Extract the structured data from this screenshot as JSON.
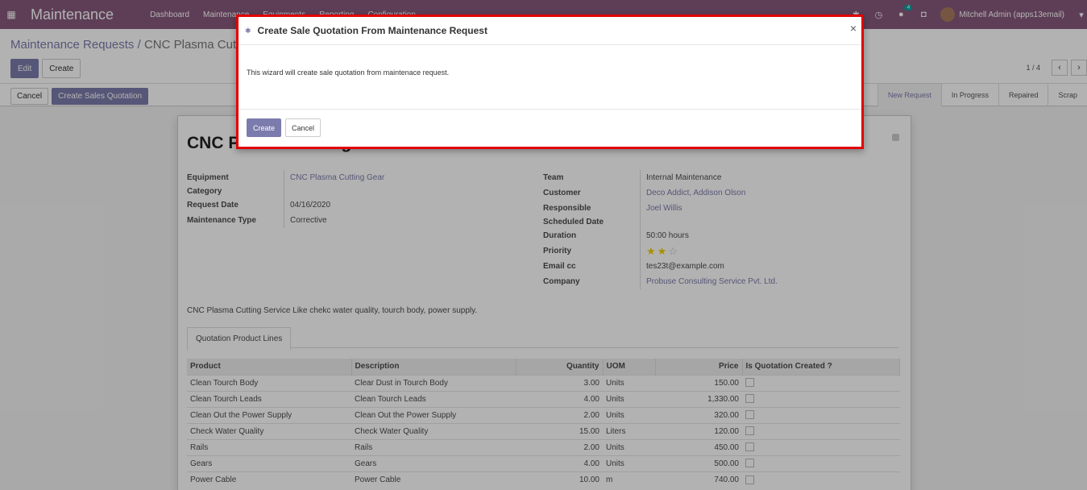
{
  "navbar": {
    "app_name": "Maintenance",
    "menu": [
      "Dashboard",
      "Maintenance",
      "Equipments",
      "Reporting",
      "Configuration"
    ],
    "chat_count": "4",
    "user": "Mitchell Admin (apps13email)"
  },
  "control": {
    "breadcrumb_parent": "Maintenance Requests",
    "breadcrumb_sep": " / ",
    "breadcrumb_current": "CNC Plasma Cutting Service",
    "edit_label": "Edit",
    "create_label": "Create",
    "pager": "1 / 4"
  },
  "statusbar": {
    "cancel_label": "Cancel",
    "create_quotation_label": "Create Sales Quotation",
    "stages": [
      "New Request",
      "In Progress",
      "Repaired",
      "Scrap"
    ],
    "active_stage": "New Request"
  },
  "form": {
    "title": "CNC Plasma Cutting Service",
    "left": [
      {
        "label": "Equipment",
        "value": "CNC Plasma Cutting Gear"
      },
      {
        "label": "Category",
        "value": ""
      },
      {
        "label": "Request Date",
        "value": "04/16/2020"
      },
      {
        "label": "Maintenance Type",
        "value": "Corrective"
      }
    ],
    "right": [
      {
        "label": "Team",
        "value": "Internal Maintenance"
      },
      {
        "label": "Customer",
        "value": "Deco Addict, Addison Olson"
      },
      {
        "label": "Responsible",
        "value": "Joel Willis"
      },
      {
        "label": "Scheduled Date",
        "value": ""
      },
      {
        "label": "Duration",
        "value": "50:00  hours"
      },
      {
        "label": "Priority",
        "value": ""
      },
      {
        "label": "Email cc",
        "value": "tes23t@example.com"
      },
      {
        "label": "Company",
        "value": "Probuse Consulting Service Pvt. Ltd."
      }
    ],
    "priority_stars": 2,
    "description": "CNC Plasma Cutting Service Like chekc water quality, tourch body, power supply.",
    "tab_label": "Quotation Product Lines",
    "columns": [
      "Product",
      "Description",
      "Quantity",
      "UOM",
      "Price",
      "Is Quotation Created ?"
    ],
    "rows": [
      [
        "Clean Tourch Body",
        "Clear Dust in Tourch Body",
        "3.00",
        "Units",
        "150.00"
      ],
      [
        "Clean Tourch Leads",
        "Clean Tourch Leads",
        "4.00",
        "Units",
        "1,330.00"
      ],
      [
        "Clean Out the Power Supply",
        "Clean Out the Power Supply",
        "2.00",
        "Units",
        "320.00"
      ],
      [
        "Check Water Quality",
        "Check Water Quality",
        "15.00",
        "Liters",
        "120.00"
      ],
      [
        "Rails",
        "Rails",
        "2.00",
        "Units",
        "450.00"
      ],
      [
        "Gears",
        "Gears",
        "4.00",
        "Units",
        "500.00"
      ],
      [
        "Power Cable",
        "Power Cable",
        "10.00",
        "m",
        "740.00"
      ]
    ]
  },
  "modal": {
    "title": "Create Sale Quotation From Maintenance Request",
    "body": "This wizard will create sale quotation from maintenace request.",
    "create_label": "Create",
    "cancel_label": "Cancel",
    "close_symbol": "×"
  },
  "colors": {
    "brand": "#875a7b",
    "primary": "#7c7bad",
    "highlight": "#e20000"
  }
}
